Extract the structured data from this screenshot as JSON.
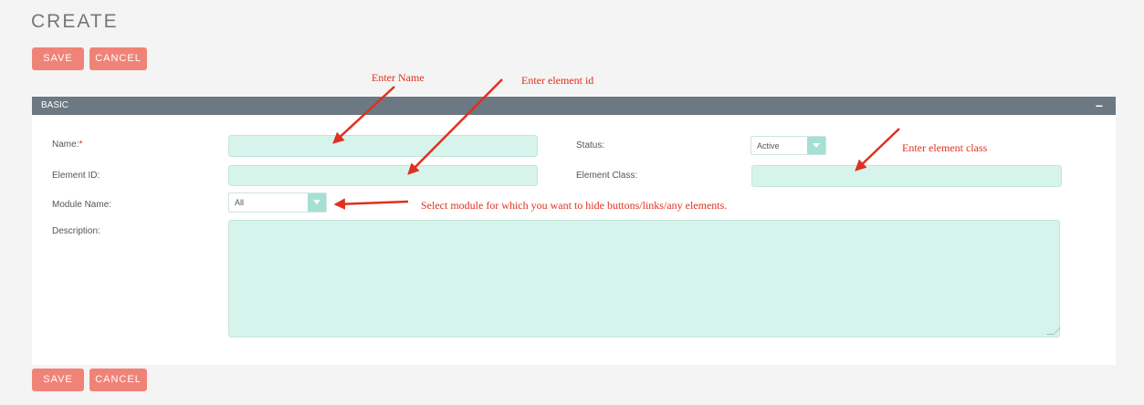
{
  "page": {
    "title": "CREATE"
  },
  "toolbar": {
    "save_label": "SAVE",
    "cancel_label": "CANCEL"
  },
  "panel": {
    "title": "BASIC",
    "collapse_label": "−",
    "fields": {
      "name": {
        "label": "Name:",
        "required_mark": "*",
        "value": ""
      },
      "element_id": {
        "label": "Element ID:",
        "value": ""
      },
      "module_name": {
        "label": "Module Name:",
        "value": "All"
      },
      "description": {
        "label": "Description:",
        "value": ""
      },
      "status": {
        "label": "Status:",
        "value": "Active"
      },
      "element_class": {
        "label": "Element Class:",
        "value": ""
      }
    }
  },
  "annotations": {
    "enter_name": "Enter Name",
    "enter_element_id": "Enter element id",
    "enter_element_class": "Enter element class",
    "select_module": "Select module for which you want to hide buttons/links/any elements."
  },
  "colors": {
    "button": "#f08377",
    "panel_header": "#6c7882",
    "field_fill": "#d6f4ec",
    "select_arrow": "#a4e0d4",
    "annotation": "#e0301e"
  }
}
